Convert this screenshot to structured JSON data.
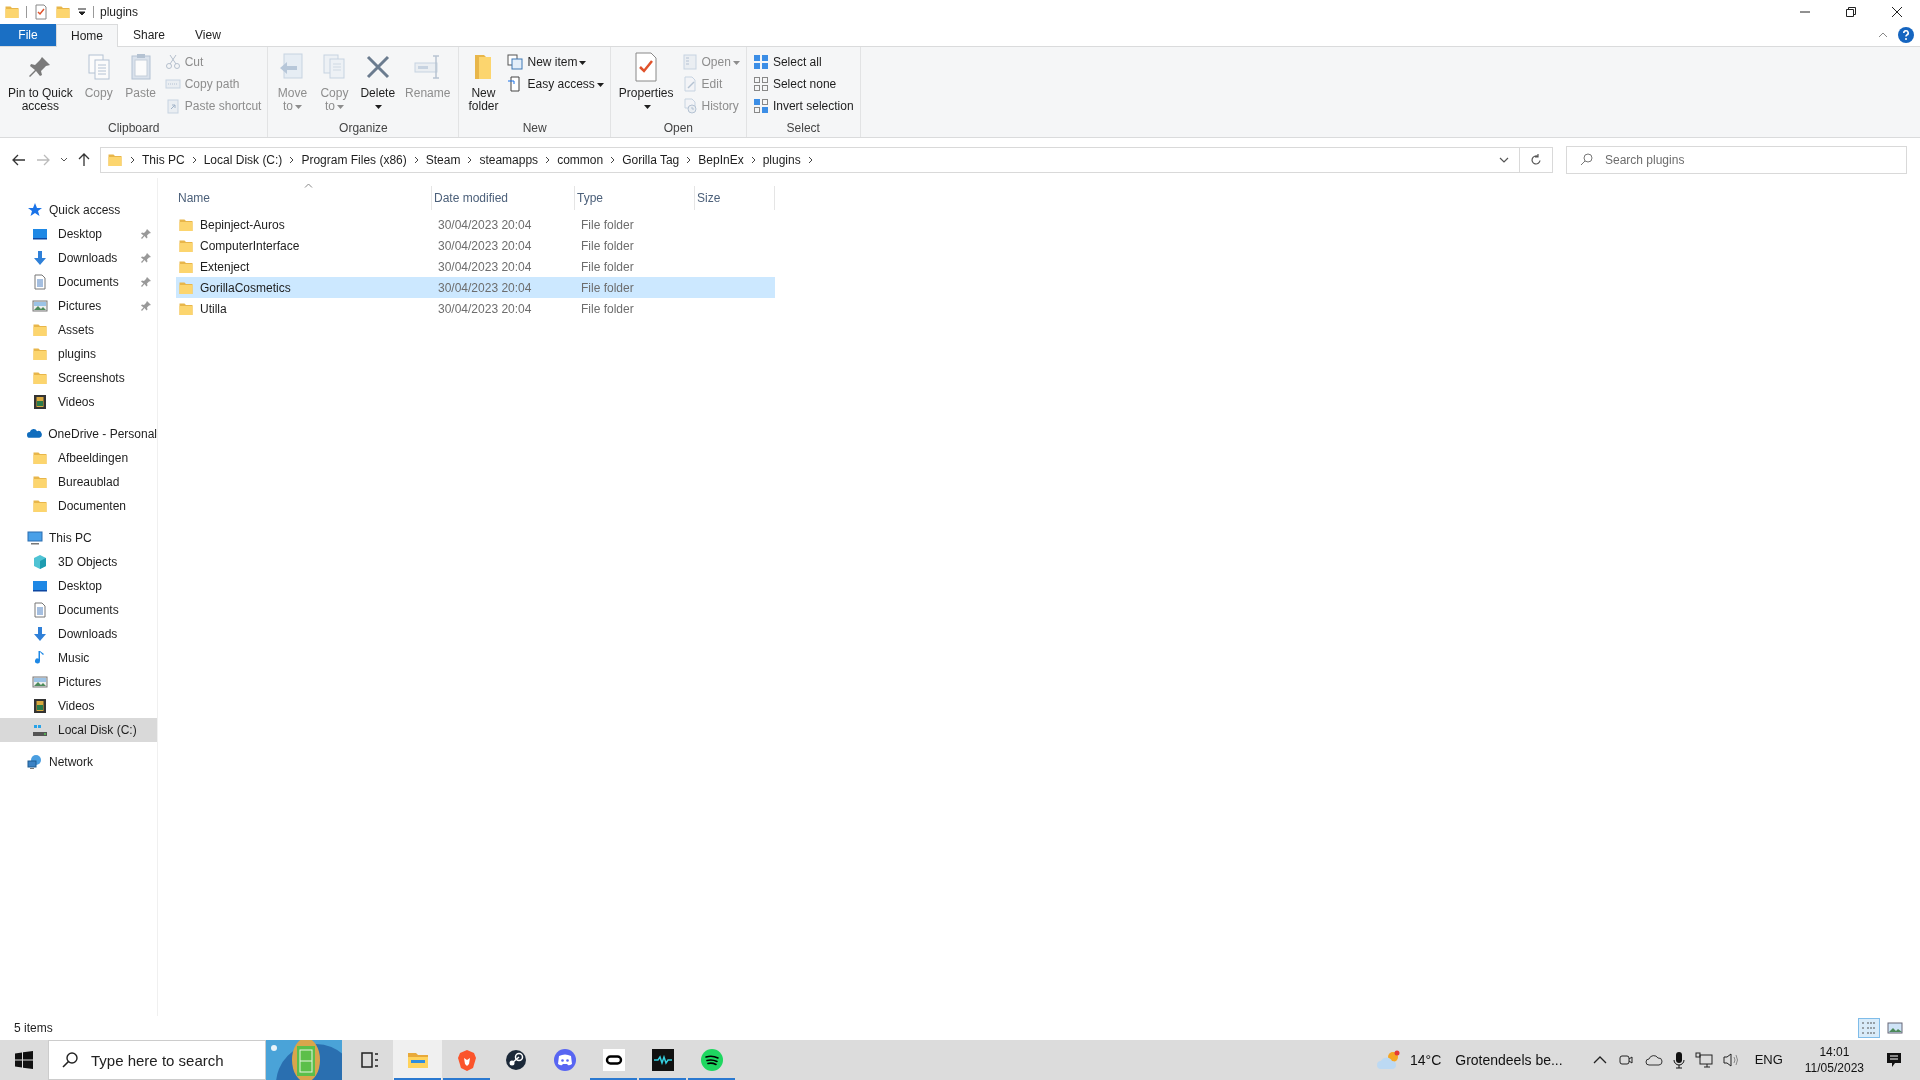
{
  "window": {
    "title": "plugins"
  },
  "ribbon_tabs": [
    {
      "label": "File",
      "kind": "file",
      "selected": false
    },
    {
      "label": "Home",
      "kind": "tab",
      "selected": true
    },
    {
      "label": "Share",
      "kind": "tab",
      "selected": false
    },
    {
      "label": "View",
      "kind": "tab",
      "selected": false
    }
  ],
  "ribbon_groups": [
    {
      "label": "Clipboard",
      "columns": [
        [
          {
            "label": "Pin to Quick\naccess",
            "kind": "pin",
            "disabled": false,
            "menu": false
          }
        ],
        [
          {
            "label": "Copy",
            "kind": "copy",
            "disabled": true,
            "menu": false
          }
        ],
        [
          {
            "label": "Paste",
            "kind": "paste",
            "disabled": true,
            "menu": false
          }
        ],
        [
          {
            "label": "Cut",
            "kind": "cut",
            "disabled": true,
            "menu": false
          },
          {
            "label": "Copy path",
            "kind": "copypath",
            "disabled": true,
            "menu": false
          },
          {
            "label": "Paste shortcut",
            "kind": "pasteshortcut",
            "disabled": true,
            "menu": false
          }
        ]
      ]
    },
    {
      "label": "Organize",
      "columns": [
        [
          {
            "label": "Move\nto",
            "kind": "move",
            "disabled": true,
            "menu": true
          }
        ],
        [
          {
            "label": "Copy\nto",
            "kind": "copyto",
            "disabled": true,
            "menu": true
          }
        ],
        [
          {
            "label": "Delete",
            "kind": "delete",
            "disabled": false,
            "menu": true
          }
        ],
        [
          {
            "label": "Rename",
            "kind": "rename",
            "disabled": true,
            "menu": false
          }
        ]
      ]
    },
    {
      "label": "New",
      "columns": [
        [
          {
            "label": "New\nfolder",
            "kind": "newfolder",
            "disabled": false,
            "menu": false
          }
        ],
        [
          {
            "label": "New item",
            "kind": "newitem",
            "disabled": false,
            "menu": true
          },
          {
            "label": "Easy access",
            "kind": "easyaccess",
            "disabled": false,
            "menu": true
          }
        ]
      ]
    },
    {
      "label": "Open",
      "columns": [
        [
          {
            "label": "Properties",
            "kind": "properties",
            "disabled": false,
            "menu": true
          }
        ],
        [
          {
            "label": "Open",
            "kind": "open",
            "disabled": true,
            "menu": true
          },
          {
            "label": "Edit",
            "kind": "edit",
            "disabled": true,
            "menu": false
          },
          {
            "label": "History",
            "kind": "history",
            "disabled": true,
            "menu": false
          }
        ]
      ]
    },
    {
      "label": "Select",
      "columns": [
        [
          {
            "label": "Select all",
            "kind": "selectall",
            "disabled": false,
            "menu": false
          },
          {
            "label": "Select none",
            "kind": "selectnone",
            "disabled": false,
            "menu": false
          },
          {
            "label": "Invert selection",
            "kind": "invert",
            "disabled": false,
            "menu": false
          }
        ]
      ]
    }
  ],
  "address": {
    "breadcrumbs": [
      "This PC",
      "Local Disk (C:)",
      "Program Files (x86)",
      "Steam",
      "steamapps",
      "common",
      "Gorilla Tag",
      "BepInEx",
      "plugins"
    ]
  },
  "search": {
    "placeholder": "Search plugins"
  },
  "sidebar": {
    "sections": [
      {
        "label": "Quick access",
        "kind": "star",
        "children": [
          {
            "label": "Desktop",
            "kind": "desktop",
            "pinned": true,
            "selected": false
          },
          {
            "label": "Downloads",
            "kind": "download",
            "pinned": true,
            "selected": false
          },
          {
            "label": "Documents",
            "kind": "document",
            "pinned": true,
            "selected": false
          },
          {
            "label": "Pictures",
            "kind": "picture",
            "pinned": true,
            "selected": false
          },
          {
            "label": "Assets",
            "kind": "folder",
            "pinned": false,
            "selected": false
          },
          {
            "label": "plugins",
            "kind": "folder",
            "pinned": false,
            "selected": false
          },
          {
            "label": "Screenshots",
            "kind": "folder",
            "pinned": false,
            "selected": false
          },
          {
            "label": "Videos",
            "kind": "video",
            "pinned": false,
            "selected": false
          }
        ]
      },
      {
        "label": "OneDrive - Personal",
        "kind": "cloud",
        "children": [
          {
            "label": "Afbeeldingen",
            "kind": "folder",
            "pinned": false,
            "selected": false
          },
          {
            "label": "Bureaublad",
            "kind": "folder",
            "pinned": false,
            "selected": false
          },
          {
            "label": "Documenten",
            "kind": "folder",
            "pinned": false,
            "selected": false
          }
        ]
      },
      {
        "label": "This PC",
        "kind": "pc",
        "children": [
          {
            "label": "3D Objects",
            "kind": "cube",
            "pinned": false,
            "selected": false
          },
          {
            "label": "Desktop",
            "kind": "desktop",
            "pinned": false,
            "selected": false
          },
          {
            "label": "Documents",
            "kind": "document",
            "pinned": false,
            "selected": false
          },
          {
            "label": "Downloads",
            "kind": "download",
            "pinned": false,
            "selected": false
          },
          {
            "label": "Music",
            "kind": "music",
            "pinned": false,
            "selected": false
          },
          {
            "label": "Pictures",
            "kind": "picture",
            "pinned": false,
            "selected": false
          },
          {
            "label": "Videos",
            "kind": "video",
            "pinned": false,
            "selected": false
          },
          {
            "label": "Local Disk (C:)",
            "kind": "disk",
            "pinned": false,
            "selected": true
          }
        ]
      },
      {
        "label": "Network",
        "kind": "network"
      }
    ]
  },
  "table": {
    "columns": [
      {
        "label": "Name",
        "sorted": true
      },
      {
        "label": "Date modified",
        "sorted": false
      },
      {
        "label": "Type",
        "sorted": false
      },
      {
        "label": "Size",
        "sorted": false
      }
    ],
    "rows": [
      {
        "name": "Bepinject-Auros",
        "date": "30/04/2023 20:04",
        "type": "File folder",
        "selected": false
      },
      {
        "name": "ComputerInterface",
        "date": "30/04/2023 20:04",
        "type": "File folder",
        "selected": false
      },
      {
        "name": "Extenject",
        "date": "30/04/2023 20:04",
        "type": "File folder",
        "selected": false
      },
      {
        "name": "GorillaCosmetics",
        "date": "30/04/2023 20:04",
        "type": "File folder",
        "selected": true
      },
      {
        "name": "Utilla",
        "date": "30/04/2023 20:04",
        "type": "File folder",
        "selected": false
      }
    ]
  },
  "status_bar": {
    "text": "5 items",
    "views": [
      {
        "kind": "details",
        "selected": true
      },
      {
        "kind": "large",
        "selected": false
      }
    ]
  },
  "taskbar": {
    "search_placeholder": "Type here to search",
    "apps": [
      {
        "kind": "taskview",
        "running": false,
        "active": false
      },
      {
        "kind": "explorer",
        "running": true,
        "active": true
      },
      {
        "kind": "brave",
        "running": true,
        "active": false
      },
      {
        "kind": "steam",
        "running": false,
        "active": false
      },
      {
        "kind": "discord",
        "running": false,
        "active": false
      },
      {
        "kind": "oculus",
        "running": true,
        "active": false
      },
      {
        "kind": "wave",
        "running": true,
        "active": false
      },
      {
        "kind": "spotify",
        "running": true,
        "active": false
      }
    ],
    "weather": {
      "temperature": "14°C",
      "condition": "Grotendeels be..."
    },
    "language": "ENG",
    "time": "14:01",
    "date": "11/05/2023"
  }
}
